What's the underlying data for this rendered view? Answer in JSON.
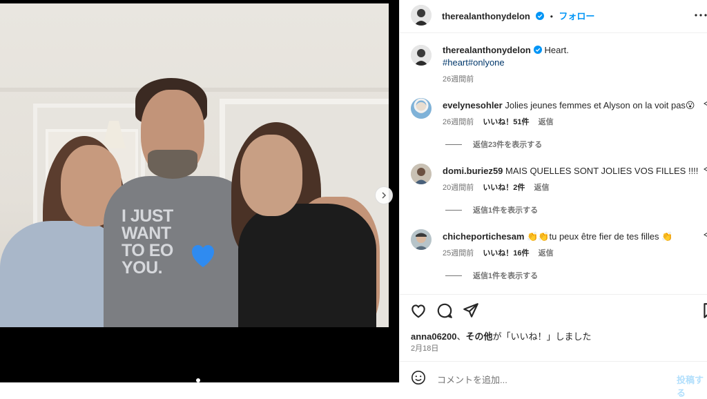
{
  "post": {
    "username": "therealanthonydelon",
    "follow_label": "フォロー",
    "separator": "•"
  },
  "photo": {
    "shirt_lines": [
      "I JUST",
      "WANT",
      "TO EO",
      "YOU."
    ]
  },
  "caption": {
    "username": "therealanthonydelon",
    "text": "Heart.",
    "hashtags": "#heart#onlyone",
    "time": "26週間前"
  },
  "comments": [
    {
      "username": "evelynesohler",
      "text": "Jolies jeunes femmes et Alyson on la voit pas😮",
      "time": "26週間前",
      "likes": "いいね！51件",
      "reply": "返信",
      "view_replies": "返信23件を表示する"
    },
    {
      "username": "domi.buriez59",
      "text": "MAIS QUELLES SONT JOLIES VOS FILLES !!!!",
      "time": "20週間前",
      "likes": "いいね！2件",
      "reply": "返信",
      "view_replies": "返信1件を表示する"
    },
    {
      "username": "chicheportichesam",
      "text": "👏👏tu peux être fier de tes filles 👏",
      "time": "25週間前",
      "likes": "いいね！16件",
      "reply": "返信",
      "view_replies": "返信1件を表示する"
    }
  ],
  "likes_line": {
    "first_liker": "anna06200",
    "middle": "、",
    "others": "その他",
    "suffix": "が「いいね！」しました"
  },
  "date": "2月18日",
  "add_comment": {
    "placeholder": "コメントを追加...",
    "post_label": "投稿する"
  },
  "colors": {
    "accent": "#0095f6",
    "hashtag": "#00376b",
    "heart": "#2f8bf0"
  }
}
